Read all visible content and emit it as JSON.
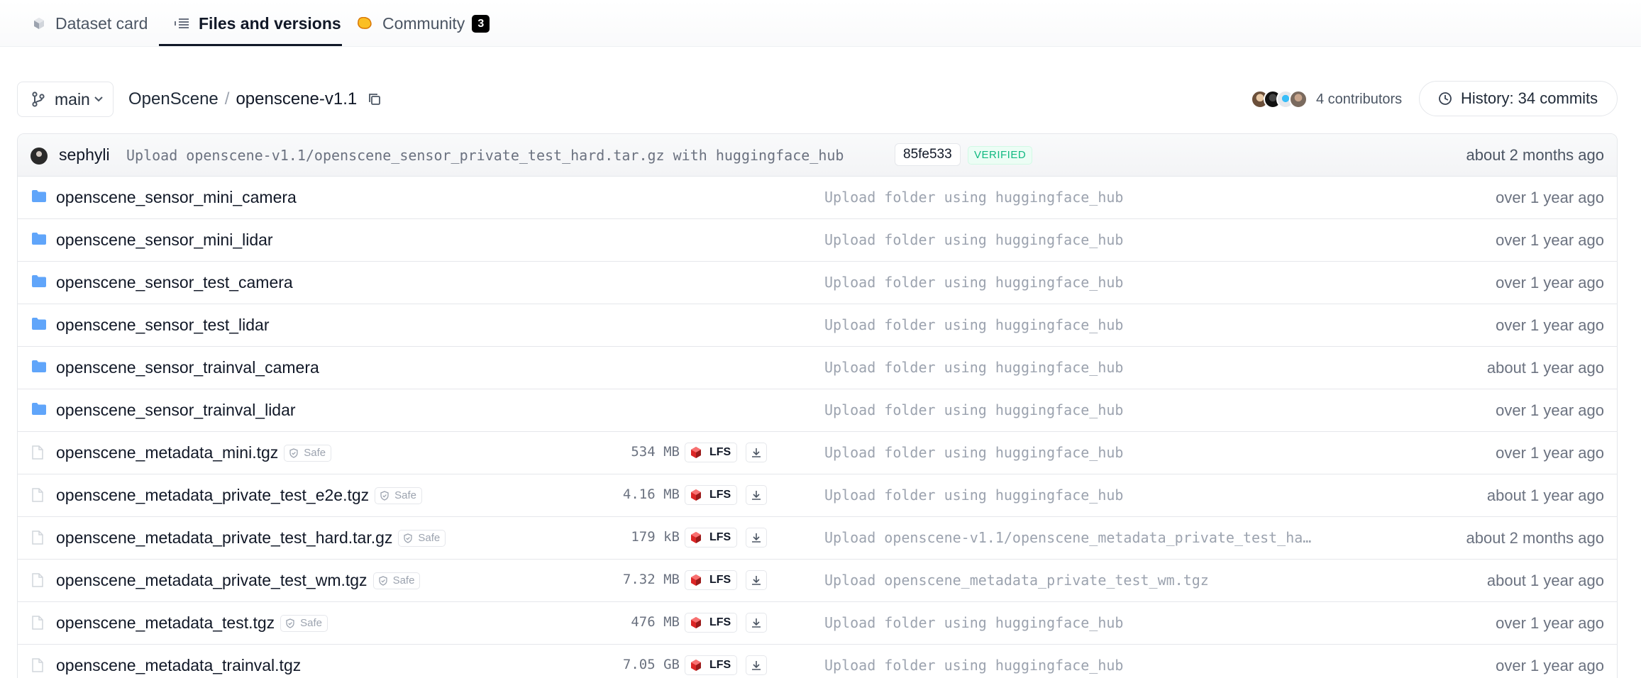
{
  "tabs": {
    "dataset_card": "Dataset card",
    "files_versions": "Files and versions",
    "community": "Community",
    "community_count": "3"
  },
  "toolbar": {
    "branch": "main",
    "owner": "OpenScene",
    "separator": "/",
    "repo": "openscene-v1.1",
    "contributors_label": "4 contributors",
    "history_label": "History: 34 commits"
  },
  "last_commit": {
    "author": "sephyli",
    "message": "Upload openscene-v1.1/openscene_sensor_private_test_hard.tar.gz with huggingface_hub",
    "hash": "85fe533",
    "verified": "VERIFIED",
    "time": "about 2 months ago"
  },
  "files": [
    {
      "type": "folder",
      "name": "openscene_sensor_mini_camera",
      "message": "Upload folder using huggingface_hub",
      "time": "over 1 year ago"
    },
    {
      "type": "folder",
      "name": "openscene_sensor_mini_lidar",
      "message": "Upload folder using huggingface_hub",
      "time": "over 1 year ago"
    },
    {
      "type": "folder",
      "name": "openscene_sensor_test_camera",
      "message": "Upload folder using huggingface_hub",
      "time": "over 1 year ago"
    },
    {
      "type": "folder",
      "name": "openscene_sensor_test_lidar",
      "message": "Upload folder using huggingface_hub",
      "time": "over 1 year ago"
    },
    {
      "type": "folder",
      "name": "openscene_sensor_trainval_camera",
      "message": "Upload folder using huggingface_hub",
      "time": "about 1 year ago"
    },
    {
      "type": "folder",
      "name": "openscene_sensor_trainval_lidar",
      "message": "Upload folder using huggingface_hub",
      "time": "over 1 year ago"
    },
    {
      "type": "file",
      "name": "openscene_metadata_mini.tgz",
      "safe": "Safe",
      "size": "534 MB",
      "lfs": "LFS",
      "message": "Upload folder using huggingface_hub",
      "time": "over 1 year ago"
    },
    {
      "type": "file",
      "name": "openscene_metadata_private_test_e2e.tgz",
      "safe": "Safe",
      "size": "4.16 MB",
      "lfs": "LFS",
      "message": "Upload folder using huggingface_hub",
      "time": "about 1 year ago"
    },
    {
      "type": "file",
      "name": "openscene_metadata_private_test_hard.tar.gz",
      "safe": "Safe",
      "size": "179 kB",
      "lfs": "LFS",
      "message": "Upload openscene-v1.1/openscene_metadata_private_test_ha…",
      "time": "about 2 months ago"
    },
    {
      "type": "file",
      "name": "openscene_metadata_private_test_wm.tgz",
      "safe": "Safe",
      "size": "7.32 MB",
      "lfs": "LFS",
      "message": "Upload openscene_metadata_private_test_wm.tgz",
      "time": "about 1 year ago"
    },
    {
      "type": "file",
      "name": "openscene_metadata_test.tgz",
      "safe": "Safe",
      "size": "476 MB",
      "lfs": "LFS",
      "message": "Upload folder using huggingface_hub",
      "time": "over 1 year ago"
    },
    {
      "type": "file",
      "name": "openscene_metadata_trainval.tgz",
      "safe": "",
      "size": "7.05 GB",
      "lfs": "LFS",
      "message": "Upload folder using huggingface_hub",
      "time": "over 1 year ago"
    }
  ],
  "colors": {
    "folder": "#60a5fa",
    "verified": "#10b981",
    "lfs_cube": "#dc2626",
    "community_icon": "#fbbf24"
  }
}
